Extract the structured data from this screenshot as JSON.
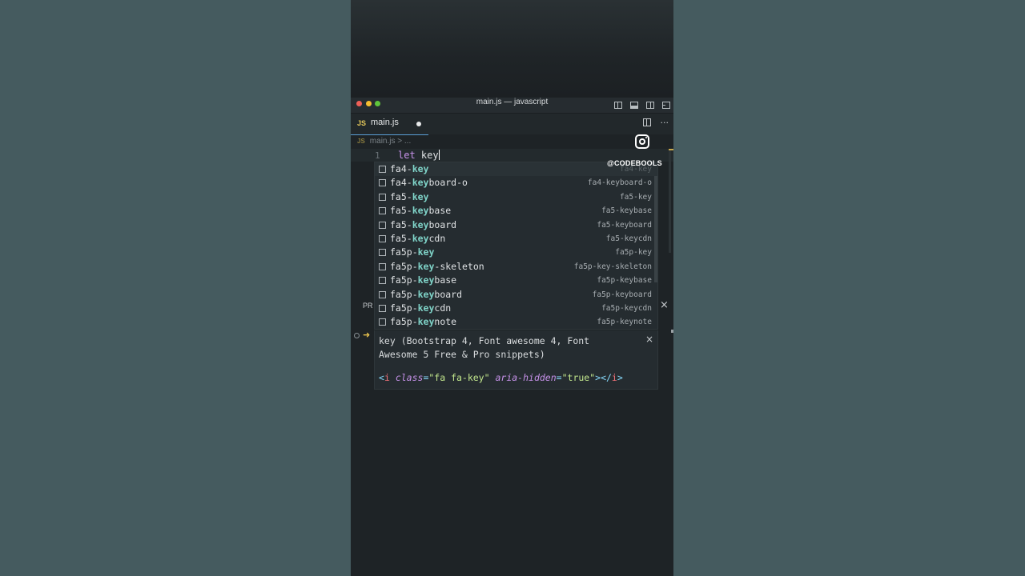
{
  "window": {
    "title": "main.js — javascript"
  },
  "tab": {
    "badge": "JS",
    "label": "main.js",
    "more": "···"
  },
  "breadcrumb": {
    "badge": "JS",
    "file": "main.js",
    "sep": ">",
    "rest": "..."
  },
  "editor": {
    "line_number": "1",
    "keyword": "let",
    "typed": "key"
  },
  "watermark": {
    "handle": "@CODEBOOLS"
  },
  "suggestions": [
    {
      "pre": "fa4-",
      "match": "key",
      "post": "",
      "detail": "fa4-key"
    },
    {
      "pre": "fa4-",
      "match": "key",
      "post": "board-o",
      "detail": "fa4-keyboard-o"
    },
    {
      "pre": "fa5-",
      "match": "key",
      "post": "",
      "detail": "fa5-key"
    },
    {
      "pre": "fa5-",
      "match": "key",
      "post": "base",
      "detail": "fa5-keybase"
    },
    {
      "pre": "fa5-",
      "match": "key",
      "post": "board",
      "detail": "fa5-keyboard"
    },
    {
      "pre": "fa5-",
      "match": "key",
      "post": "cdn",
      "detail": "fa5-keycdn"
    },
    {
      "pre": "fa5p-",
      "match": "key",
      "post": "",
      "detail": "fa5p-key"
    },
    {
      "pre": "fa5p-",
      "match": "key",
      "post": "-skeleton",
      "detail": "fa5p-key-skeleton"
    },
    {
      "pre": "fa5p-",
      "match": "key",
      "post": "base",
      "detail": "fa5p-keybase"
    },
    {
      "pre": "fa5p-",
      "match": "key",
      "post": "board",
      "detail": "fa5p-keyboard"
    },
    {
      "pre": "fa5p-",
      "match": "key",
      "post": "cdn",
      "detail": "fa5p-keycdn"
    },
    {
      "pre": "fa5p-",
      "match": "key",
      "post": "note",
      "detail": "fa5p-keynote"
    }
  ],
  "details": {
    "description": "key (Bootstrap 4, Font awesome 4, Font Awesome 5 Free & Pro snippets)",
    "close": "×",
    "snippet": {
      "lt": "<",
      "tag": "i",
      "attr1": "class",
      "eq": "=",
      "val1": "\"fa fa-key\"",
      "attr2": "aria-hidden",
      "val2": "\"true\"",
      "close": "></",
      "tag2": "i",
      "gt": ">"
    }
  },
  "panel": {
    "label": "PR",
    "close": "×",
    "prompt": "➜"
  },
  "colors": {
    "background": "#445a5e",
    "editor": "#1e2326",
    "match_highlight": "#7fd3c8",
    "keyword": "#c792ea",
    "js_badge": "#e3c75a"
  }
}
